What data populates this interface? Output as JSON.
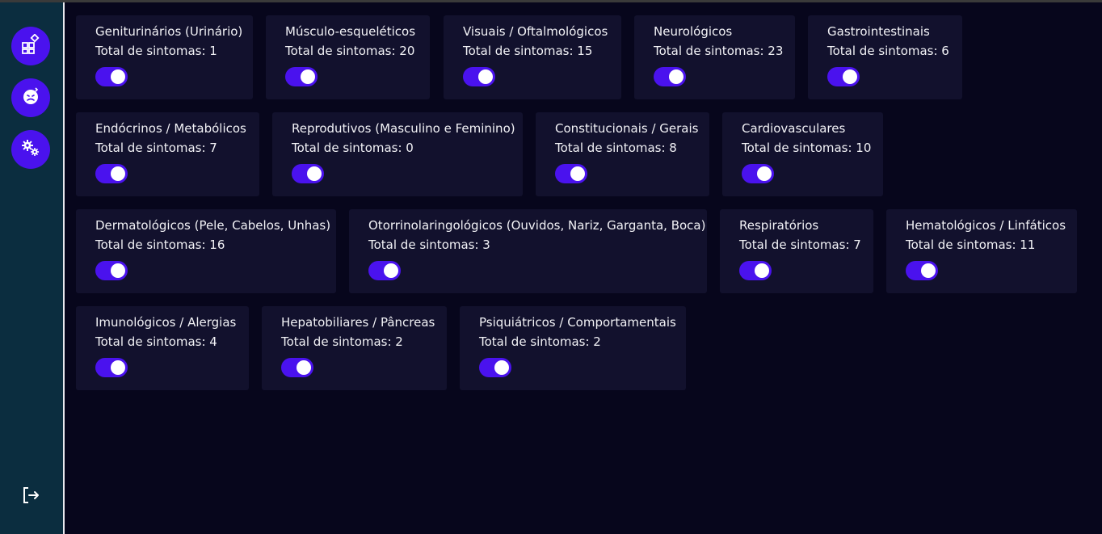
{
  "colors": {
    "accent": "#4a12ee",
    "background": "#07061c",
    "card": "#12112d",
    "sidebar": "#0b2d3f"
  },
  "sidebar": {
    "items": [
      {
        "icon": "dashboard-icon"
      },
      {
        "icon": "sick-face-icon"
      },
      {
        "icon": "gears-icon"
      }
    ],
    "logout_icon": "logout-icon"
  },
  "cards": [
    {
      "title": "Geniturinários (Urinário)",
      "total": "Total de sintomas: 1",
      "enabled": true
    },
    {
      "title": "Músculo-esqueléticos",
      "total": "Total de sintomas: 20",
      "enabled": true
    },
    {
      "title": "Visuais / Oftalmológicos",
      "total": "Total de sintomas: 15",
      "enabled": true
    },
    {
      "title": "Neurológicos",
      "total": "Total de sintomas: 23",
      "enabled": true
    },
    {
      "title": "Gastrointestinais",
      "total": "Total de sintomas: 6",
      "enabled": true
    },
    {
      "title": "Endócrinos / Metabólicos",
      "total": "Total de sintomas: 7",
      "enabled": true
    },
    {
      "title": "Reprodutivos (Masculino e Feminino)",
      "total": "Total de sintomas: 0",
      "enabled": true
    },
    {
      "title": "Constitucionais / Gerais",
      "total": "Total de sintomas: 8",
      "enabled": true
    },
    {
      "title": "Cardiovasculares",
      "total": "Total de sintomas: 10",
      "enabled": true
    },
    {
      "title": "Dermatológicos (Pele, Cabelos, Unhas)",
      "total": "Total de sintomas: 16",
      "enabled": true
    },
    {
      "title": "Otorrinolaringológicos (Ouvidos, Nariz, Garganta, Boca)",
      "total": "Total de sintomas: 3",
      "enabled": true
    },
    {
      "title": "Respiratórios",
      "total": "Total de sintomas: 7",
      "enabled": true
    },
    {
      "title": "Hematológicos / Linfáticos",
      "total": "Total de sintomas: 11",
      "enabled": true
    },
    {
      "title": "Imunológicos / Alergias",
      "total": "Total de sintomas: 4",
      "enabled": true
    },
    {
      "title": "Hepatobiliares / Pâncreas",
      "total": "Total de sintomas: 2",
      "enabled": true
    },
    {
      "title": "Psiquiátricos / Comportamentais",
      "total": "Total de sintomas: 2",
      "enabled": true
    }
  ]
}
